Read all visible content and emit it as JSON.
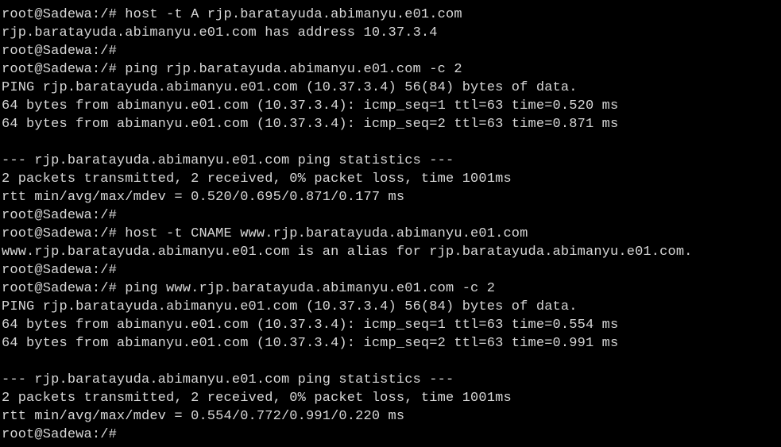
{
  "terminal": {
    "lines": [
      "root@Sadewa:/# host -t A rjp.baratayuda.abimanyu.e01.com",
      "rjp.baratayuda.abimanyu.e01.com has address 10.37.3.4",
      "root@Sadewa:/#",
      "root@Sadewa:/# ping rjp.baratayuda.abimanyu.e01.com -c 2",
      "PING rjp.baratayuda.abimanyu.e01.com (10.37.3.4) 56(84) bytes of data.",
      "64 bytes from abimanyu.e01.com (10.37.3.4): icmp_seq=1 ttl=63 time=0.520 ms",
      "64 bytes from abimanyu.e01.com (10.37.3.4): icmp_seq=2 ttl=63 time=0.871 ms",
      "",
      "--- rjp.baratayuda.abimanyu.e01.com ping statistics ---",
      "2 packets transmitted, 2 received, 0% packet loss, time 1001ms",
      "rtt min/avg/max/mdev = 0.520/0.695/0.871/0.177 ms",
      "root@Sadewa:/#",
      "root@Sadewa:/# host -t CNAME www.rjp.baratayuda.abimanyu.e01.com",
      "www.rjp.baratayuda.abimanyu.e01.com is an alias for rjp.baratayuda.abimanyu.e01.com.",
      "root@Sadewa:/#",
      "root@Sadewa:/# ping www.rjp.baratayuda.abimanyu.e01.com -c 2",
      "PING rjp.baratayuda.abimanyu.e01.com (10.37.3.4) 56(84) bytes of data.",
      "64 bytes from abimanyu.e01.com (10.37.3.4): icmp_seq=1 ttl=63 time=0.554 ms",
      "64 bytes from abimanyu.e01.com (10.37.3.4): icmp_seq=2 ttl=63 time=0.991 ms",
      "",
      "--- rjp.baratayuda.abimanyu.e01.com ping statistics ---",
      "2 packets transmitted, 2 received, 0% packet loss, time 1001ms",
      "rtt min/avg/max/mdev = 0.554/0.772/0.991/0.220 ms"
    ],
    "prompt": "root@Sadewa:/# ",
    "colors": {
      "background": "#000000",
      "text": "#d7d7d7"
    }
  }
}
